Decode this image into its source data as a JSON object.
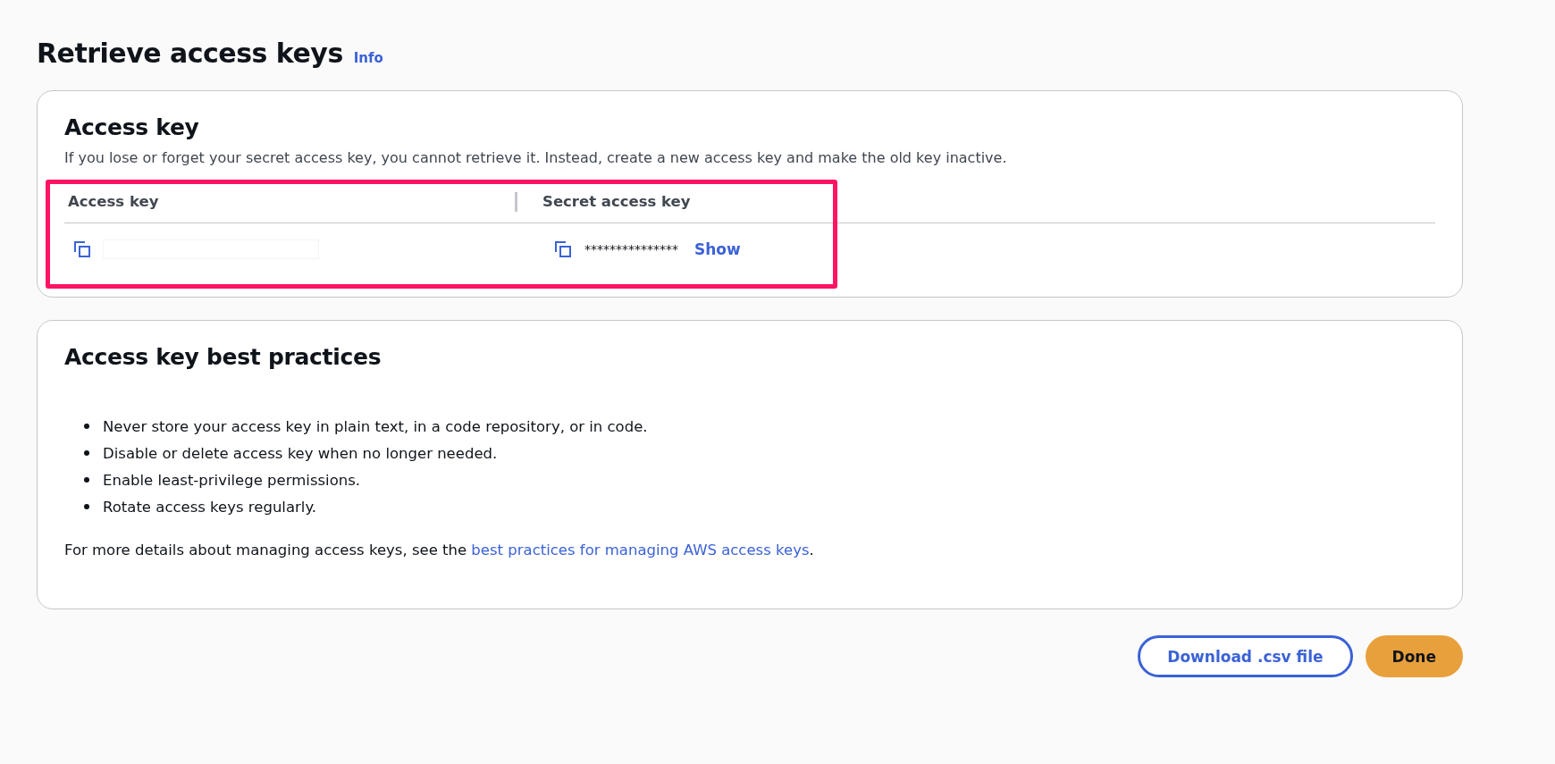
{
  "page_title": "Retrieve access keys",
  "info_link": "Info",
  "access_key_panel": {
    "heading": "Access key",
    "description": "If you lose or forget your secret access key, you cannot retrieve it. Instead, create a new access key and make the old key inactive.",
    "columns": [
      "Access key",
      "Secret access key"
    ],
    "secret_value": "***************",
    "show_link": "Show"
  },
  "best_practices_panel": {
    "heading": "Access key best practices",
    "items": [
      "Never store your access key in plain text, in a code repository, or in code.",
      "Disable or delete access key when no longer needed.",
      "Enable least-privilege permissions.",
      "Rotate access keys regularly."
    ],
    "footer": {
      "before": "For more details about managing access keys, see the ",
      "link": "best practices for managing AWS access keys",
      "after": "."
    }
  },
  "buttons": [
    {
      "label": "Download .csv file",
      "kind": "secondary"
    },
    {
      "label": "Done",
      "kind": "primary"
    }
  ]
}
